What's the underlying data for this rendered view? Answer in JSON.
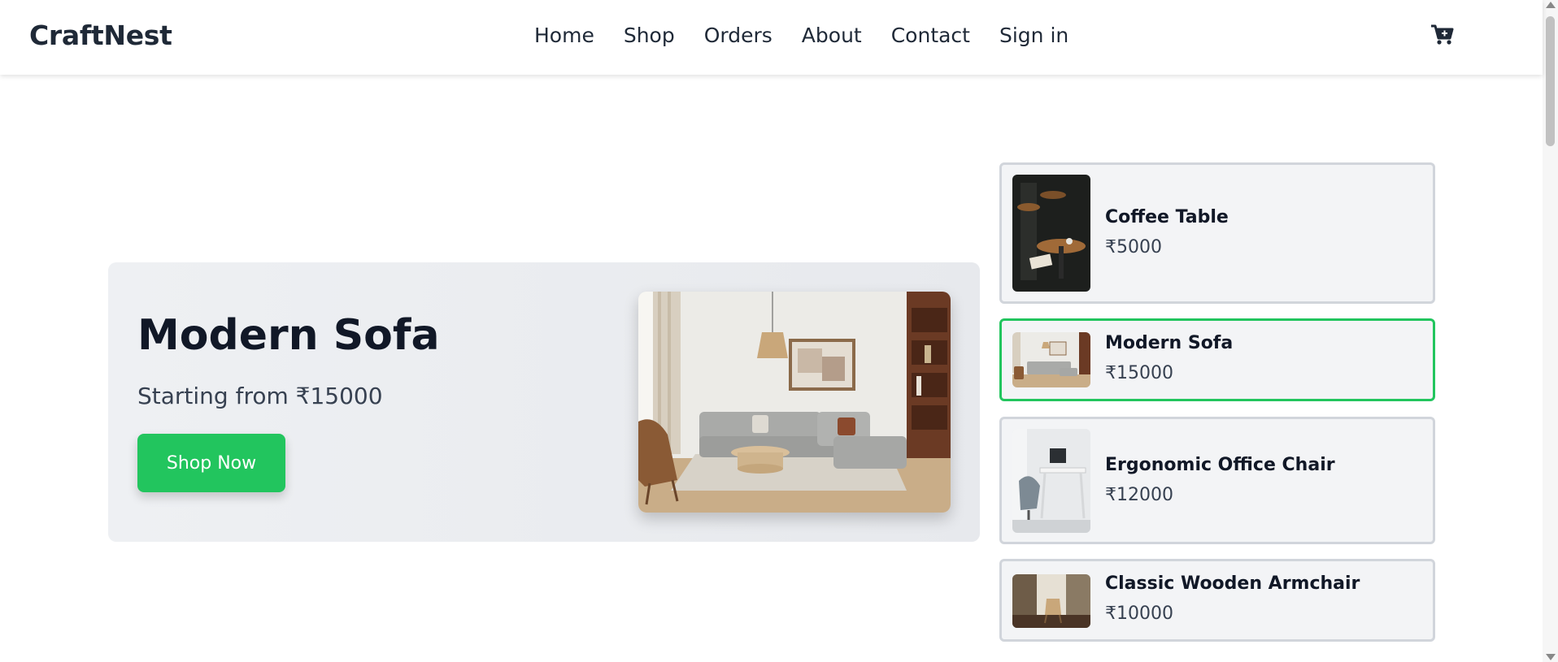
{
  "brand": "CraftNest",
  "nav": {
    "home": "Home",
    "shop": "Shop",
    "orders": "Orders",
    "about": "About",
    "contact": "Contact",
    "signin": "Sign in"
  },
  "cart_icon": "cart-plus-icon",
  "hero": {
    "title": "Modern Sofa",
    "subtitle": "Starting from ₹15000",
    "button": "Shop Now",
    "image": "living-room-sofa-photo"
  },
  "products": [
    {
      "name": "Coffee Table",
      "price": "₹5000",
      "selected": false
    },
    {
      "name": "Modern Sofa",
      "price": "₹15000",
      "selected": true
    },
    {
      "name": "Ergonomic Office Chair",
      "price": "₹12000",
      "selected": false
    },
    {
      "name": "Classic Wooden Armchair",
      "price": "₹10000",
      "selected": false
    }
  ],
  "colors": {
    "accent": "#22c55e",
    "text": "#111827",
    "card_bg": "#f3f4f6",
    "card_border": "#d1d5db"
  }
}
